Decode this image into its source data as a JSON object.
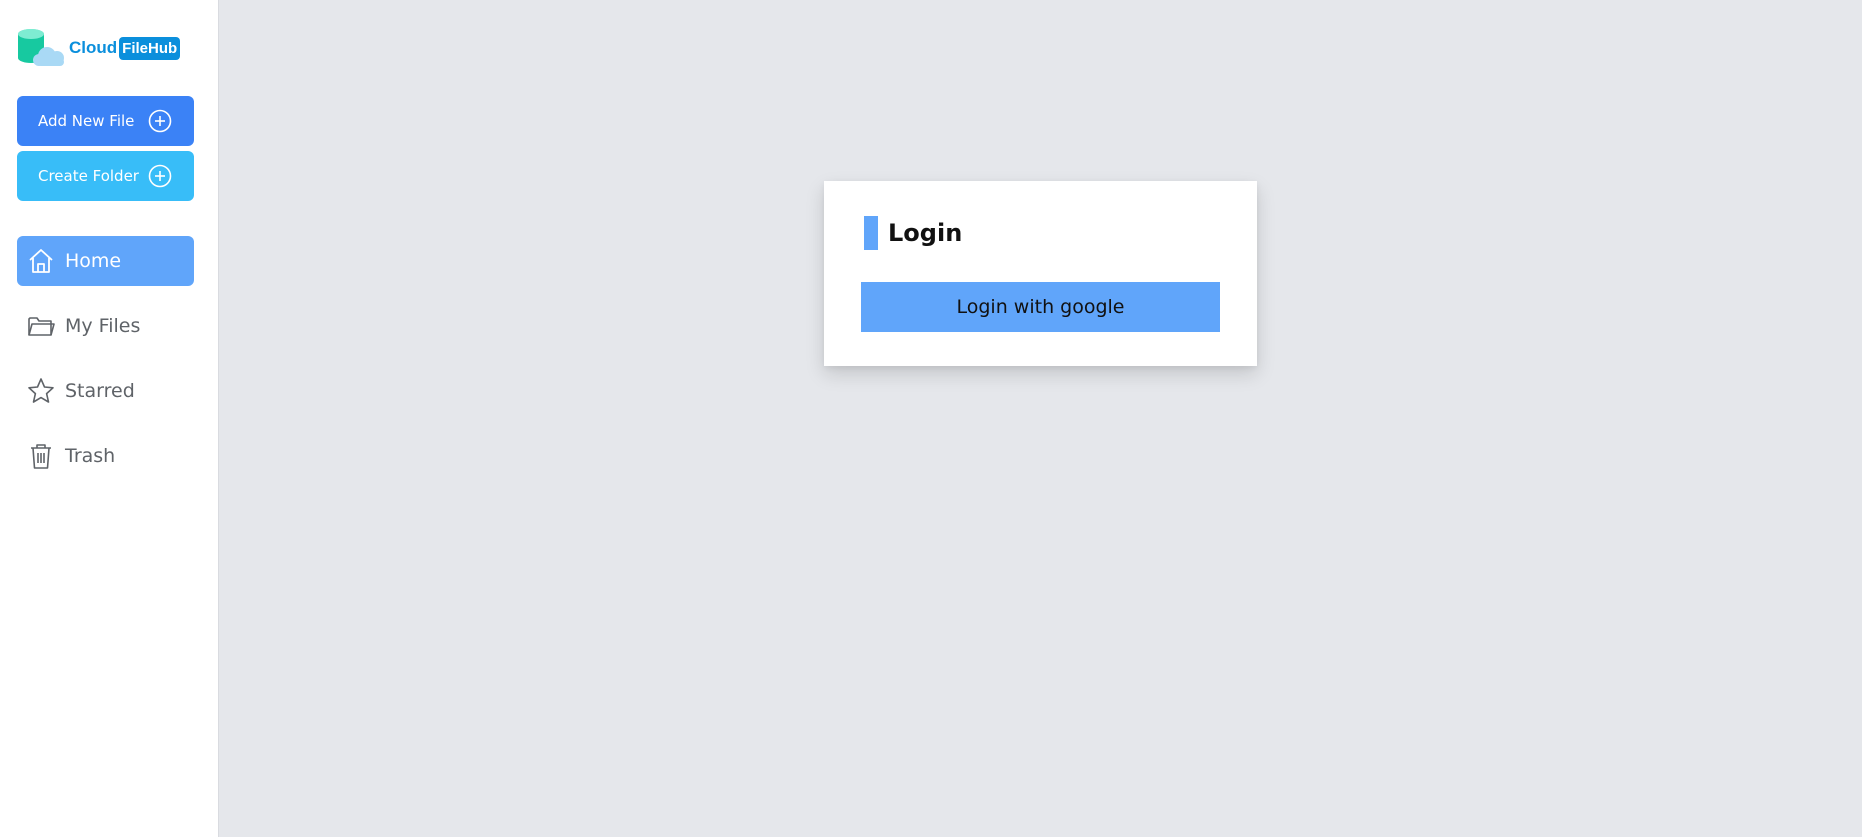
{
  "brand": {
    "name_part1": "Cloud",
    "name_part2": "FileHub"
  },
  "actions": {
    "add_file_label": "Add New File",
    "create_folder_label": "Create Folder"
  },
  "nav": {
    "items": [
      {
        "label": "Home",
        "icon": "home-icon",
        "active": true
      },
      {
        "label": "My Files",
        "icon": "folder-icon",
        "active": false
      },
      {
        "label": "Starred",
        "icon": "star-icon",
        "active": false
      },
      {
        "label": "Trash",
        "icon": "trash-icon",
        "active": false
      }
    ]
  },
  "login": {
    "title": "Login",
    "google_button_label": "Login with google"
  },
  "colors": {
    "background": "#e5e7eb",
    "primary_blue": "#3b82f6",
    "sky_blue": "#38bdf8",
    "active_blue": "#60a5fa",
    "brand_blue": "#0b8fdc"
  }
}
